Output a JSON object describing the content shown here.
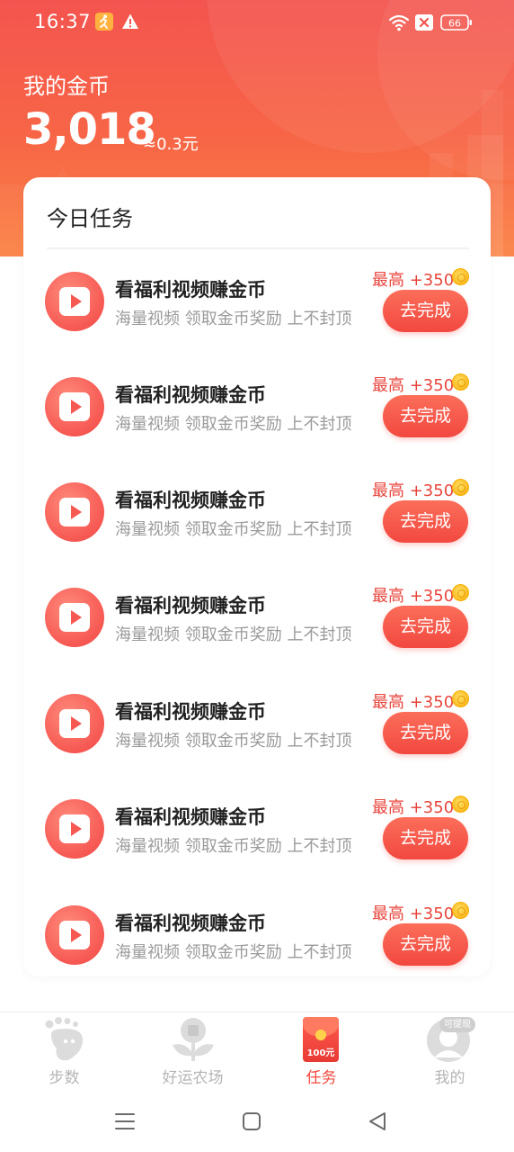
{
  "status_bar": {
    "time": "16:37",
    "battery": "66",
    "icons": [
      "runner-app-icon",
      "warning-icon",
      "wifi-icon",
      "sim-off-icon",
      "battery-icon"
    ]
  },
  "header": {
    "label": "我的金币",
    "coins": "3,018",
    "rmb_equivalent": "≈0.3元"
  },
  "tasks_card": {
    "title": "今日任务",
    "tasks": [
      {
        "title": "看福利视频赚金币",
        "desc": "海量视频 领取金币奖励 上不封顶",
        "reward": "最高 +350",
        "button": "去完成"
      },
      {
        "title": "看福利视频赚金币",
        "desc": "海量视频 领取金币奖励 上不封顶",
        "reward": "最高 +350",
        "button": "去完成"
      },
      {
        "title": "看福利视频赚金币",
        "desc": "海量视频 领取金币奖励 上不封顶",
        "reward": "最高 +350",
        "button": "去完成"
      },
      {
        "title": "看福利视频赚金币",
        "desc": "海量视频 领取金币奖励 上不封顶",
        "reward": "最高 +350",
        "button": "去完成"
      },
      {
        "title": "看福利视频赚金币",
        "desc": "海量视频 领取金币奖励 上不封顶",
        "reward": "最高 +350",
        "button": "去完成"
      },
      {
        "title": "看福利视频赚金币",
        "desc": "海量视频 领取金币奖励 上不封顶",
        "reward": "最高 +350",
        "button": "去完成"
      },
      {
        "title": "看福利视频赚金币",
        "desc": "海量视频 领取金币奖励 上不封顶",
        "reward": "最高 +350",
        "button": "去完成"
      }
    ]
  },
  "tabbar": {
    "tabs": [
      {
        "label": "步数",
        "icon": "steps-footprint-icon",
        "active": false
      },
      {
        "label": "好运农场",
        "icon": "farm-sprout-icon",
        "active": false
      },
      {
        "label": "任务",
        "icon": "red-envelope-icon",
        "badge": "100元",
        "active": true
      },
      {
        "label": "我的",
        "icon": "profile-avatar-icon",
        "badge": "可提现",
        "active": false
      }
    ]
  },
  "nav_bar": {
    "icons": [
      "menu-icon",
      "home-icon",
      "back-icon"
    ]
  },
  "colors": {
    "accent": "#f2483f",
    "header_top": "#f4544f",
    "header_bottom": "#fb8346",
    "inactive_tab": "#b5b5b5"
  }
}
